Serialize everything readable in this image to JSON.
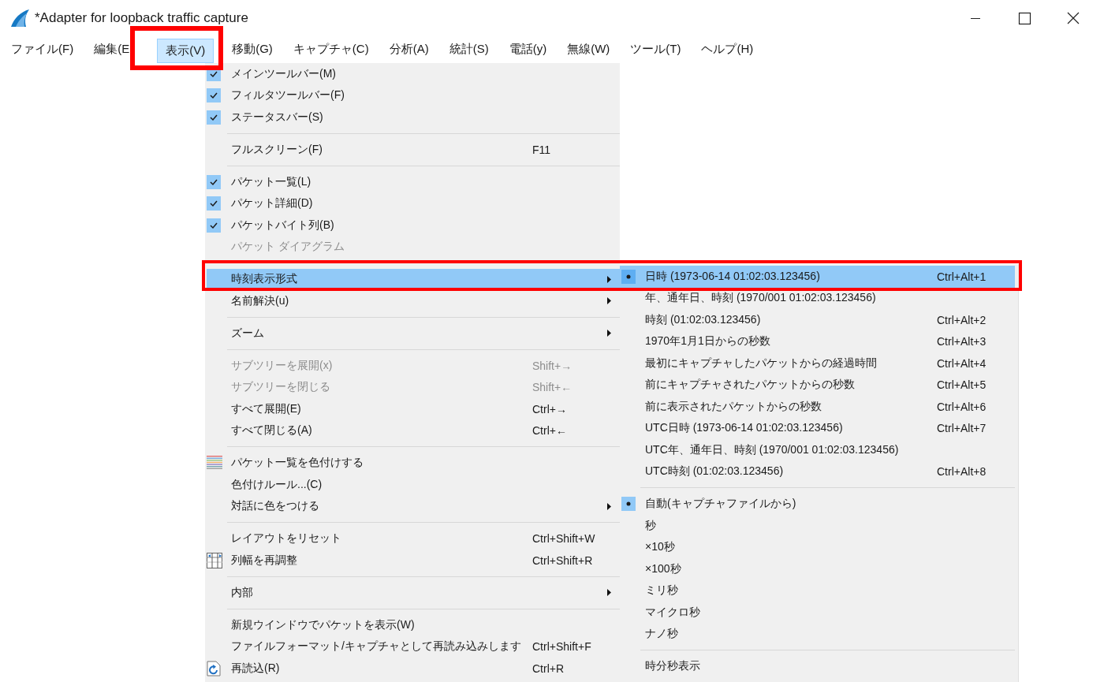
{
  "window": {
    "title": "*Adapter for loopback traffic capture"
  },
  "menubar": [
    {
      "label": "ファイル(F)",
      "selected": false
    },
    {
      "label": "編集(E",
      "selected": false
    },
    {
      "label": "表示(V)",
      "selected": true
    },
    {
      "label": "移動(G)",
      "selected": false
    },
    {
      "label": "キャプチャ(C)",
      "selected": false
    },
    {
      "label": "分析(A)",
      "selected": false
    },
    {
      "label": "統計(S)",
      "selected": false
    },
    {
      "label": "電話(y)",
      "selected": false
    },
    {
      "label": "無線(W)",
      "selected": false
    },
    {
      "label": "ツール(T)",
      "selected": false
    },
    {
      "label": "ヘルプ(H)",
      "selected": false
    }
  ],
  "view_menu": {
    "items": [
      {
        "kind": "check",
        "label": "メインツールバー(M)",
        "checked": true,
        "disabled": false,
        "selected": false
      },
      {
        "kind": "check",
        "label": "フィルタツールバー(F)",
        "checked": true,
        "disabled": false,
        "selected": false
      },
      {
        "kind": "check",
        "label": "ステータスバー(S)",
        "checked": true,
        "disabled": false,
        "selected": false
      },
      {
        "kind": "separator"
      },
      {
        "kind": "plain",
        "label": "フルスクリーン(F)",
        "shortcut": "F11",
        "disabled": false,
        "selected": false
      },
      {
        "kind": "separator"
      },
      {
        "kind": "check",
        "label": "パケット一覧(L)",
        "checked": true,
        "disabled": false,
        "selected": false
      },
      {
        "kind": "check",
        "label": "パケット詳細(D)",
        "checked": true,
        "disabled": false,
        "selected": false
      },
      {
        "kind": "check",
        "label": "パケットバイト列(B)",
        "checked": true,
        "disabled": false,
        "selected": false
      },
      {
        "kind": "plain",
        "label": "パケット ダイアグラム",
        "disabled": true,
        "selected": false
      },
      {
        "kind": "separator"
      },
      {
        "kind": "submenu",
        "label": "時刻表示形式",
        "disabled": false,
        "selected": true
      },
      {
        "kind": "submenu",
        "label": "名前解決(u)",
        "disabled": false,
        "selected": false
      },
      {
        "kind": "separator"
      },
      {
        "kind": "submenu",
        "label": "ズーム",
        "disabled": false,
        "selected": false
      },
      {
        "kind": "separator"
      },
      {
        "kind": "plain",
        "label": "サブツリーを展開(x)",
        "shortcut": "Shift+→",
        "disabled": true,
        "selected": false
      },
      {
        "kind": "plain",
        "label": "サブツリーを閉じる",
        "shortcut": "Shift+←",
        "disabled": true,
        "selected": false
      },
      {
        "kind": "plain",
        "label": "すべて展開(E)",
        "shortcut": "Ctrl+→",
        "disabled": false,
        "selected": false
      },
      {
        "kind": "plain",
        "label": "すべて閉じる(A)",
        "shortcut": "Ctrl+←",
        "disabled": false,
        "selected": false
      },
      {
        "kind": "separator"
      },
      {
        "kind": "stripes",
        "label": "パケット一覧を色付けする",
        "disabled": false,
        "selected": false
      },
      {
        "kind": "plain",
        "label": "色付けルール...(C)",
        "disabled": false,
        "selected": false
      },
      {
        "kind": "submenu",
        "label": "対話に色をつける",
        "disabled": false,
        "selected": false
      },
      {
        "kind": "separator"
      },
      {
        "kind": "plain",
        "label": "レイアウトをリセット",
        "shortcut": "Ctrl+Shift+W",
        "disabled": false,
        "selected": false
      },
      {
        "kind": "columns",
        "label": "列幅を再調整",
        "shortcut": "Ctrl+Shift+R",
        "disabled": false,
        "selected": false
      },
      {
        "kind": "separator"
      },
      {
        "kind": "submenu",
        "label": "内部",
        "disabled": false,
        "selected": false
      },
      {
        "kind": "separator"
      },
      {
        "kind": "plain",
        "label": "新規ウインドウでパケットを表示(W)",
        "disabled": false,
        "selected": false
      },
      {
        "kind": "plain",
        "label": "ファイルフォーマット/キャプチャとして再読み込みします",
        "shortcut": "Ctrl+Shift+F",
        "disabled": false,
        "selected": false
      },
      {
        "kind": "reload",
        "label": "再読込(R)",
        "shortcut": "Ctrl+R",
        "disabled": false,
        "selected": false
      }
    ]
  },
  "time_format_submenu": {
    "items": [
      {
        "kind": "radio",
        "label": "日時 (1973-06-14 01:02:03.123456)",
        "shortcut": "Ctrl+Alt+1",
        "checked": true,
        "selected": true
      },
      {
        "kind": "radio",
        "label": "年、通年日、時刻 (1970/001 01:02:03.123456)",
        "checked": false,
        "selected": false
      },
      {
        "kind": "radio",
        "label": "時刻 (01:02:03.123456)",
        "shortcut": "Ctrl+Alt+2",
        "checked": false,
        "selected": false
      },
      {
        "kind": "radio",
        "label": "1970年1月1日からの秒数",
        "shortcut": "Ctrl+Alt+3",
        "checked": false,
        "selected": false
      },
      {
        "kind": "radio",
        "label": "最初にキャプチャしたパケットからの経過時間",
        "shortcut": "Ctrl+Alt+4",
        "checked": false,
        "selected": false
      },
      {
        "kind": "radio",
        "label": "前にキャプチャされたパケットからの秒数",
        "shortcut": "Ctrl+Alt+5",
        "checked": false,
        "selected": false
      },
      {
        "kind": "radio",
        "label": "前に表示されたパケットからの秒数",
        "shortcut": "Ctrl+Alt+6",
        "checked": false,
        "selected": false
      },
      {
        "kind": "radio",
        "label": "UTC日時 (1973-06-14 01:02:03.123456)",
        "shortcut": "Ctrl+Alt+7",
        "checked": false,
        "selected": false
      },
      {
        "kind": "radio",
        "label": "UTC年、通年日、時刻 (1970/001 01:02:03.123456)",
        "checked": false,
        "selected": false
      },
      {
        "kind": "radio",
        "label": "UTC時刻 (01:02:03.123456)",
        "shortcut": "Ctrl+Alt+8",
        "checked": false,
        "selected": false
      },
      {
        "kind": "separator"
      },
      {
        "kind": "radio",
        "label": "自動(キャプチャファイルから)",
        "checked": true,
        "selected": false
      },
      {
        "kind": "radio",
        "label": "秒",
        "checked": false,
        "selected": false
      },
      {
        "kind": "radio",
        "label": "×10秒",
        "checked": false,
        "selected": false
      },
      {
        "kind": "radio",
        "label": "×100秒",
        "checked": false,
        "selected": false
      },
      {
        "kind": "radio",
        "label": "ミリ秒",
        "checked": false,
        "selected": false
      },
      {
        "kind": "radio",
        "label": "マイクロ秒",
        "checked": false,
        "selected": false
      },
      {
        "kind": "radio",
        "label": "ナノ秒",
        "checked": false,
        "selected": false
      },
      {
        "kind": "separator"
      },
      {
        "kind": "check",
        "label": "時分秒表示",
        "checked": false,
        "selected": false
      }
    ]
  }
}
